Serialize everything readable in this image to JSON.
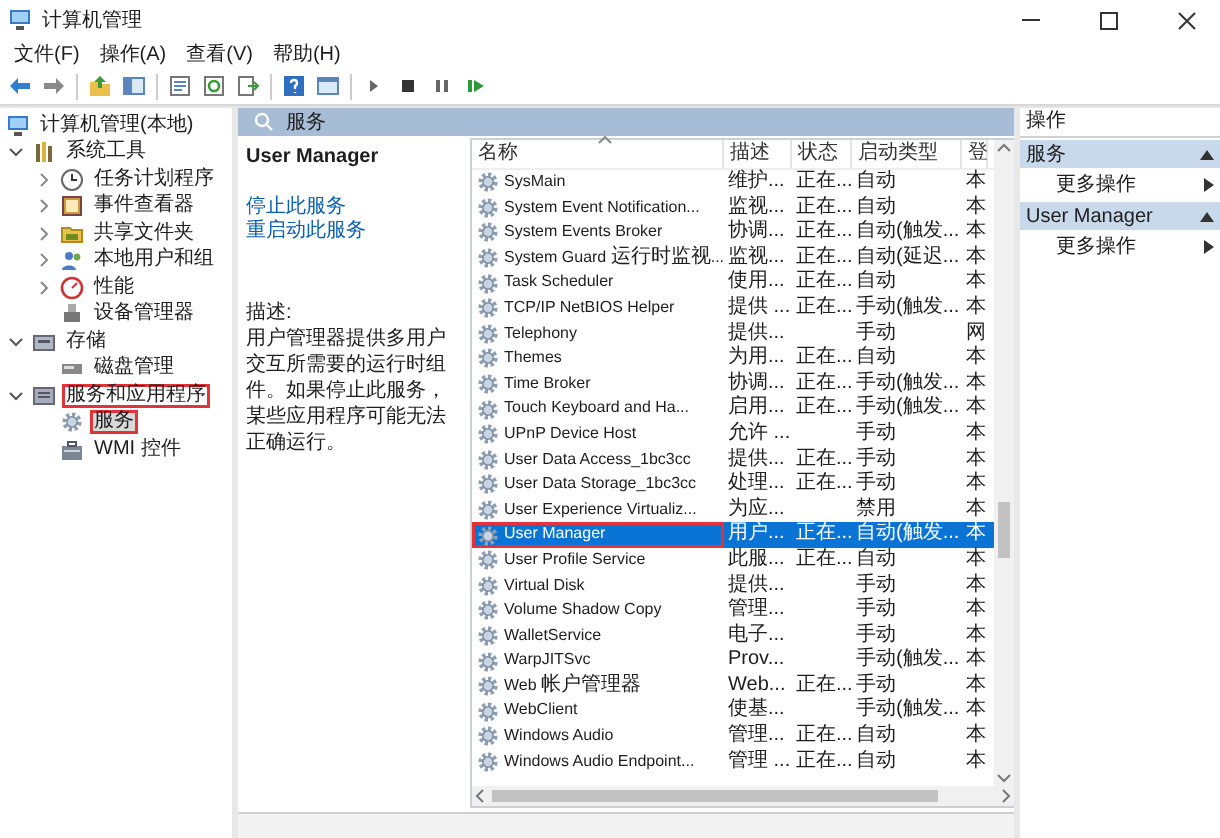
{
  "window": {
    "title": "计算机管理"
  },
  "menu": [
    "文件(F)",
    "操作(A)",
    "查看(V)",
    "帮助(H)"
  ],
  "tree": [
    {
      "label": "计算机管理(本地)",
      "kind": "computer",
      "expandable": false,
      "selected": false,
      "annotated": false,
      "children": [
        {
          "label": "系统工具",
          "kind": "tools",
          "expandable": true,
          "expanded": true,
          "selected": false,
          "annotated": false,
          "children": [
            {
              "label": "任务计划程序",
              "kind": "clock",
              "expandable": true,
              "expanded": false,
              "selected": false,
              "annotated": false
            },
            {
              "label": "事件查看器",
              "kind": "log",
              "expandable": true,
              "expanded": false,
              "selected": false,
              "annotated": false
            },
            {
              "label": "共享文件夹",
              "kind": "folder",
              "expandable": true,
              "expanded": false,
              "selected": false,
              "annotated": false
            },
            {
              "label": "本地用户和组",
              "kind": "users",
              "expandable": true,
              "expanded": false,
              "selected": false,
              "annotated": false
            },
            {
              "label": "性能",
              "kind": "gauge",
              "expandable": true,
              "expanded": false,
              "selected": false,
              "annotated": false
            },
            {
              "label": "设备管理器",
              "kind": "device",
              "expandable": false,
              "selected": false,
              "annotated": false
            }
          ]
        },
        {
          "label": "存储",
          "kind": "storage",
          "expandable": true,
          "expanded": true,
          "selected": false,
          "annotated": false,
          "children": [
            {
              "label": "磁盘管理",
              "kind": "disk",
              "expandable": false,
              "selected": false,
              "annotated": false
            }
          ]
        },
        {
          "label": "服务和应用程序",
          "kind": "apps",
          "expandable": true,
          "expanded": true,
          "selected": false,
          "annotated": true,
          "children": [
            {
              "label": "服务",
              "kind": "gear",
              "expandable": false,
              "selected": true,
              "annotated": true
            },
            {
              "label": "WMI 控件",
              "kind": "wmi",
              "expandable": false,
              "selected": false,
              "annotated": false
            }
          ]
        }
      ]
    }
  ],
  "panel": {
    "title": "服务"
  },
  "detail": {
    "title": "User Manager",
    "actions": [
      "停止此服务",
      "重启动此服务"
    ],
    "description_label": "描述:",
    "description": "用户管理器提供多用户交互所需要的运行时组件。如果停止此服务，某些应用程序可能无法正确运行。"
  },
  "columns": [
    {
      "label": "名称",
      "sorted": true
    },
    {
      "label": "描述",
      "sorted": false
    },
    {
      "label": "状态",
      "sorted": false
    },
    {
      "label": "启动类型",
      "sorted": false
    },
    {
      "label": "登",
      "sorted": false
    }
  ],
  "rows": [
    {
      "name": "SysMain",
      "description": "维护...",
      "status": "正在...",
      "startup": "自动",
      "logon": "本",
      "selected": false,
      "annotated": false
    },
    {
      "name": "System Event Notification...",
      "description": "监视...",
      "status": "正在...",
      "startup": "自动",
      "logon": "本",
      "selected": false,
      "annotated": false
    },
    {
      "name": "System Events Broker",
      "description": "协调...",
      "status": "正在...",
      "startup": "自动(触发...",
      "logon": "本",
      "selected": false,
      "annotated": false
    },
    {
      "name": "System Guard 运行时监视...",
      "description": "监视...",
      "status": "正在...",
      "startup": "自动(延迟...",
      "logon": "本",
      "selected": false,
      "annotated": false
    },
    {
      "name": "Task Scheduler",
      "description": "使用...",
      "status": "正在...",
      "startup": "自动",
      "logon": "本",
      "selected": false,
      "annotated": false
    },
    {
      "name": "TCP/IP NetBIOS Helper",
      "description": "提供 ...",
      "status": "正在...",
      "startup": "手动(触发...",
      "logon": "本",
      "selected": false,
      "annotated": false
    },
    {
      "name": "Telephony",
      "description": "提供...",
      "startup": "手动",
      "logon": "网",
      "selected": false,
      "annotated": false
    },
    {
      "name": "Themes",
      "description": "为用...",
      "status": "正在...",
      "startup": "自动",
      "logon": "本",
      "selected": false,
      "annotated": false
    },
    {
      "name": "Time Broker",
      "description": "协调...",
      "status": "正在...",
      "startup": "手动(触发...",
      "logon": "本",
      "selected": false,
      "annotated": false
    },
    {
      "name": "Touch Keyboard and Ha...",
      "description": "启用...",
      "status": "正在...",
      "startup": "手动(触发...",
      "logon": "本",
      "selected": false,
      "annotated": false
    },
    {
      "name": "UPnP Device Host",
      "description": "允许 ...",
      "startup": "手动",
      "logon": "本",
      "selected": false,
      "annotated": false
    },
    {
      "name": "User Data Access_1bc3cc",
      "description": "提供...",
      "status": "正在...",
      "startup": "手动",
      "logon": "本",
      "selected": false,
      "annotated": false
    },
    {
      "name": "User Data Storage_1bc3cc",
      "description": "处理...",
      "status": "正在...",
      "startup": "手动",
      "logon": "本",
      "selected": false,
      "annotated": false
    },
    {
      "name": "User Experience Virtualiz...",
      "description": "为应...",
      "startup": "禁用",
      "logon": "本",
      "selected": false,
      "annotated": false
    },
    {
      "name": "User Manager",
      "description": "用户...",
      "status": "正在...",
      "startup": "自动(触发...",
      "logon": "本",
      "selected": true,
      "annotated": true
    },
    {
      "name": "User Profile Service",
      "description": "此服...",
      "status": "正在...",
      "startup": "自动",
      "logon": "本",
      "selected": false,
      "annotated": false
    },
    {
      "name": "Virtual Disk",
      "description": "提供...",
      "startup": "手动",
      "logon": "本",
      "selected": false,
      "annotated": false
    },
    {
      "name": "Volume Shadow Copy",
      "description": "管理...",
      "startup": "手动",
      "logon": "本",
      "selected": false,
      "annotated": false
    },
    {
      "name": "WalletService",
      "description": "电子...",
      "startup": "手动",
      "logon": "本",
      "selected": false,
      "annotated": false
    },
    {
      "name": "WarpJITSvc",
      "description": "Prov...",
      "startup": "手动(触发...",
      "logon": "本",
      "selected": false,
      "annotated": false
    },
    {
      "name": "Web 帐户管理器",
      "description": "Web...",
      "status": "正在...",
      "startup": "手动",
      "logon": "本",
      "selected": false,
      "annotated": false
    },
    {
      "name": "WebClient",
      "description": "使基...",
      "startup": "手动(触发...",
      "logon": "本",
      "selected": false,
      "annotated": false
    },
    {
      "name": "Windows Audio",
      "description": "管理...",
      "status": "正在...",
      "startup": "自动",
      "logon": "本",
      "selected": false,
      "annotated": false
    },
    {
      "name": "Windows Audio Endpoint...",
      "description": "管理 ...",
      "status": "正在...",
      "startup": "自动",
      "logon": "本",
      "selected": false,
      "annotated": false
    }
  ],
  "actions": {
    "title": "操作",
    "sections": [
      {
        "title": "服务",
        "items": [
          "更多操作"
        ]
      },
      {
        "title": "User Manager",
        "items": [
          "更多操作"
        ]
      }
    ]
  }
}
